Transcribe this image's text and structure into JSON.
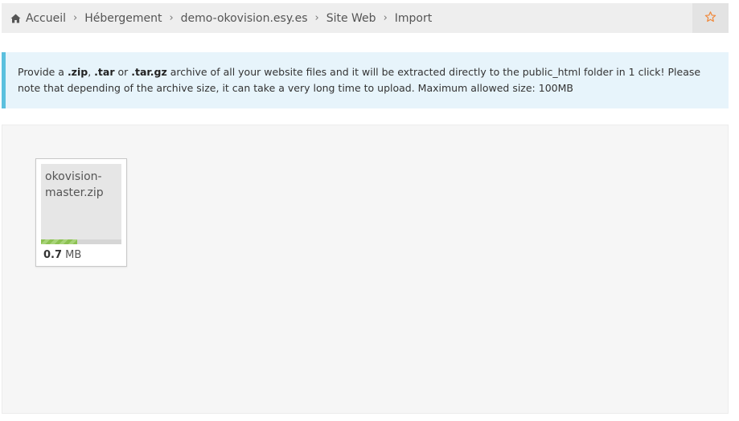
{
  "breadcrumb": {
    "items": [
      {
        "label": "Accueil",
        "icon": "home-icon"
      },
      {
        "label": "Hébergement"
      },
      {
        "label": "demo-okovision.esy.es"
      },
      {
        "label": "Site Web"
      },
      {
        "label": "Import"
      }
    ],
    "separator": "›",
    "favorite_icon": "star-icon"
  },
  "info_alert": {
    "text_1": "Provide a ",
    "ext_zip": ".zip",
    "text_2": ", ",
    "ext_tar": ".tar",
    "text_3": " or ",
    "ext_targz": ".tar.gz",
    "text_4": " archive of all your website files and it will be extracted directly to the public_html folder in 1 click! Please note that depending of the archive size, it can take a very long time to upload. Maximum allowed size: 100MB"
  },
  "upload": {
    "file": {
      "name": "okovision-master.zip",
      "size_value": "0.7",
      "size_unit": "MB",
      "progress": 0.45
    }
  },
  "colors": {
    "accent_orange": "#f0883a",
    "alert_border": "#5bc0de",
    "progress_green": "#8cc152"
  }
}
